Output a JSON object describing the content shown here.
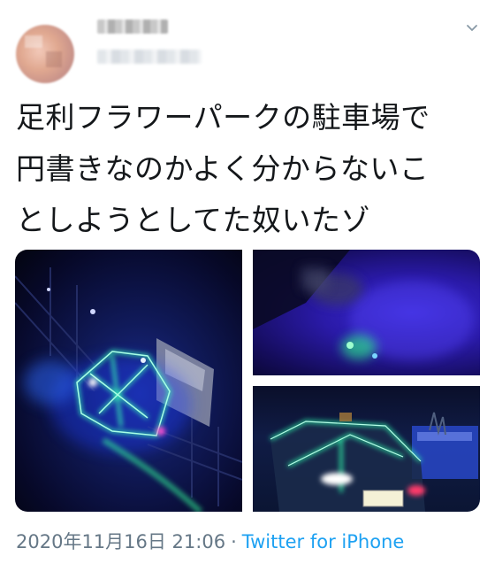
{
  "tweet": {
    "author_name": "",
    "author_handle": "",
    "text": "足利フラワーパークの駐車場で\n円書きなのかよく分からないこ\nとしようとしてた奴いたゾ",
    "timestamp": "2020年11月16日 21:06",
    "separator": "·",
    "source": "Twitter for iPhone"
  },
  "icons": {
    "menu": "chevron-down-icon"
  },
  "colors": {
    "text": "#14171a",
    "muted": "#657786",
    "link": "#1da1f2"
  }
}
